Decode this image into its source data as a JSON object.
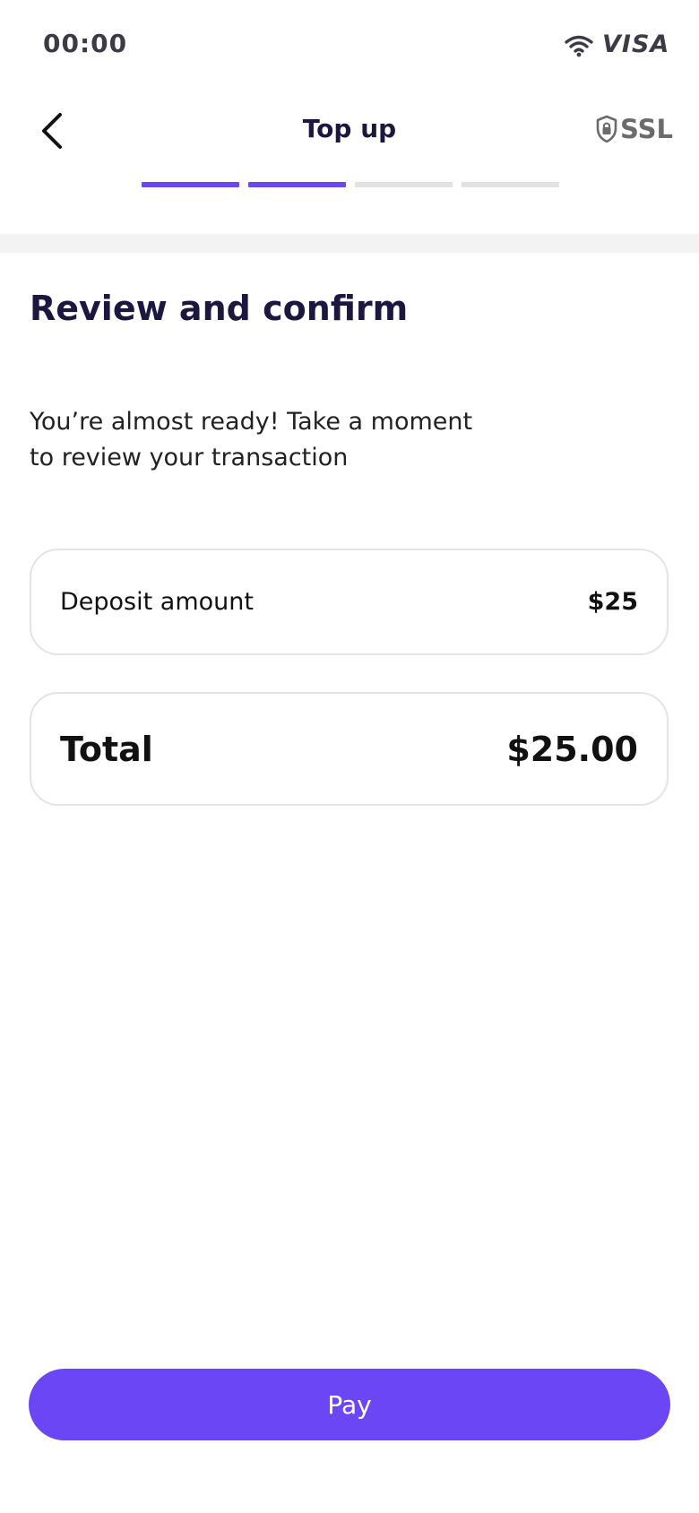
{
  "status_bar": {
    "time": "00:00",
    "card_brand": "VISA",
    "icons": [
      "wifi-icon"
    ]
  },
  "header": {
    "title": "Top up",
    "back_icon": "chevron-left-icon",
    "security_label": "SSL",
    "security_icon": "lock-shield-icon"
  },
  "progress": {
    "total_steps": 4,
    "completed_steps": 2,
    "active_color": "#6a46f5",
    "inactive_color": "#e2e2e2"
  },
  "main": {
    "heading": "Review and confirm",
    "intro_line1": "You’re almost ready! Take a moment",
    "intro_line2": "to review your transaction",
    "deposit": {
      "label": "Deposit amount",
      "value": "$25"
    },
    "total": {
      "label": "Total",
      "value": "$25.00"
    }
  },
  "footer": {
    "pay_label": "Pay"
  },
  "colors": {
    "accent": "#6a46f5",
    "heading": "#1c1740"
  }
}
